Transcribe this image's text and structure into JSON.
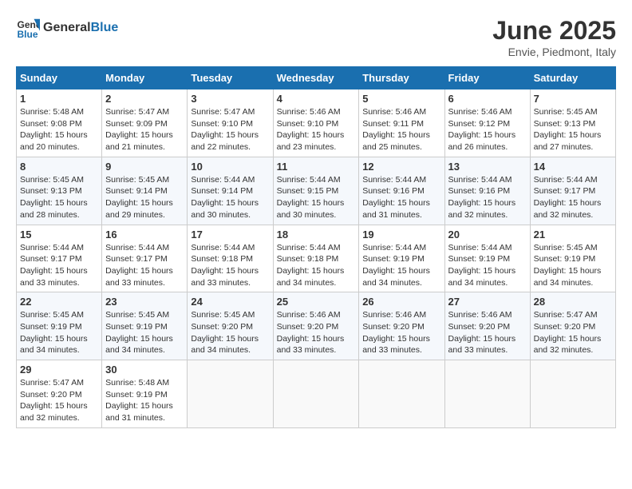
{
  "header": {
    "logo_general": "General",
    "logo_blue": "Blue",
    "title": "June 2025",
    "subtitle": "Envie, Piedmont, Italy"
  },
  "calendar": {
    "days_of_week": [
      "Sunday",
      "Monday",
      "Tuesday",
      "Wednesday",
      "Thursday",
      "Friday",
      "Saturday"
    ],
    "weeks": [
      [
        null,
        {
          "day": 2,
          "sunrise": "5:47 AM",
          "sunset": "9:09 PM",
          "daylight": "15 hours and 21 minutes."
        },
        {
          "day": 3,
          "sunrise": "5:47 AM",
          "sunset": "9:10 PM",
          "daylight": "15 hours and 22 minutes."
        },
        {
          "day": 4,
          "sunrise": "5:46 AM",
          "sunset": "9:10 PM",
          "daylight": "15 hours and 23 minutes."
        },
        {
          "day": 5,
          "sunrise": "5:46 AM",
          "sunset": "9:11 PM",
          "daylight": "15 hours and 25 minutes."
        },
        {
          "day": 6,
          "sunrise": "5:46 AM",
          "sunset": "9:12 PM",
          "daylight": "15 hours and 26 minutes."
        },
        {
          "day": 7,
          "sunrise": "5:45 AM",
          "sunset": "9:13 PM",
          "daylight": "15 hours and 27 minutes."
        }
      ],
      [
        {
          "day": 8,
          "sunrise": "5:45 AM",
          "sunset": "9:13 PM",
          "daylight": "15 hours and 28 minutes."
        },
        {
          "day": 9,
          "sunrise": "5:45 AM",
          "sunset": "9:14 PM",
          "daylight": "15 hours and 29 minutes."
        },
        {
          "day": 10,
          "sunrise": "5:44 AM",
          "sunset": "9:14 PM",
          "daylight": "15 hours and 30 minutes."
        },
        {
          "day": 11,
          "sunrise": "5:44 AM",
          "sunset": "9:15 PM",
          "daylight": "15 hours and 30 minutes."
        },
        {
          "day": 12,
          "sunrise": "5:44 AM",
          "sunset": "9:16 PM",
          "daylight": "15 hours and 31 minutes."
        },
        {
          "day": 13,
          "sunrise": "5:44 AM",
          "sunset": "9:16 PM",
          "daylight": "15 hours and 32 minutes."
        },
        {
          "day": 14,
          "sunrise": "5:44 AM",
          "sunset": "9:17 PM",
          "daylight": "15 hours and 32 minutes."
        }
      ],
      [
        {
          "day": 15,
          "sunrise": "5:44 AM",
          "sunset": "9:17 PM",
          "daylight": "15 hours and 33 minutes."
        },
        {
          "day": 16,
          "sunrise": "5:44 AM",
          "sunset": "9:17 PM",
          "daylight": "15 hours and 33 minutes."
        },
        {
          "day": 17,
          "sunrise": "5:44 AM",
          "sunset": "9:18 PM",
          "daylight": "15 hours and 33 minutes."
        },
        {
          "day": 18,
          "sunrise": "5:44 AM",
          "sunset": "9:18 PM",
          "daylight": "15 hours and 34 minutes."
        },
        {
          "day": 19,
          "sunrise": "5:44 AM",
          "sunset": "9:19 PM",
          "daylight": "15 hours and 34 minutes."
        },
        {
          "day": 20,
          "sunrise": "5:44 AM",
          "sunset": "9:19 PM",
          "daylight": "15 hours and 34 minutes."
        },
        {
          "day": 21,
          "sunrise": "5:45 AM",
          "sunset": "9:19 PM",
          "daylight": "15 hours and 34 minutes."
        }
      ],
      [
        {
          "day": 22,
          "sunrise": "5:45 AM",
          "sunset": "9:19 PM",
          "daylight": "15 hours and 34 minutes."
        },
        {
          "day": 23,
          "sunrise": "5:45 AM",
          "sunset": "9:19 PM",
          "daylight": "15 hours and 34 minutes."
        },
        {
          "day": 24,
          "sunrise": "5:45 AM",
          "sunset": "9:20 PM",
          "daylight": "15 hours and 34 minutes."
        },
        {
          "day": 25,
          "sunrise": "5:46 AM",
          "sunset": "9:20 PM",
          "daylight": "15 hours and 33 minutes."
        },
        {
          "day": 26,
          "sunrise": "5:46 AM",
          "sunset": "9:20 PM",
          "daylight": "15 hours and 33 minutes."
        },
        {
          "day": 27,
          "sunrise": "5:46 AM",
          "sunset": "9:20 PM",
          "daylight": "15 hours and 33 minutes."
        },
        {
          "day": 28,
          "sunrise": "5:47 AM",
          "sunset": "9:20 PM",
          "daylight": "15 hours and 32 minutes."
        }
      ],
      [
        {
          "day": 29,
          "sunrise": "5:47 AM",
          "sunset": "9:20 PM",
          "daylight": "15 hours and 32 minutes."
        },
        {
          "day": 30,
          "sunrise": "5:48 AM",
          "sunset": "9:19 PM",
          "daylight": "15 hours and 31 minutes."
        },
        null,
        null,
        null,
        null,
        null
      ]
    ],
    "week1_day1": {
      "day": 1,
      "sunrise": "5:48 AM",
      "sunset": "9:08 PM",
      "daylight": "15 hours and 20 minutes."
    }
  },
  "labels": {
    "sunrise": "Sunrise:",
    "sunset": "Sunset:",
    "daylight": "Daylight:"
  }
}
